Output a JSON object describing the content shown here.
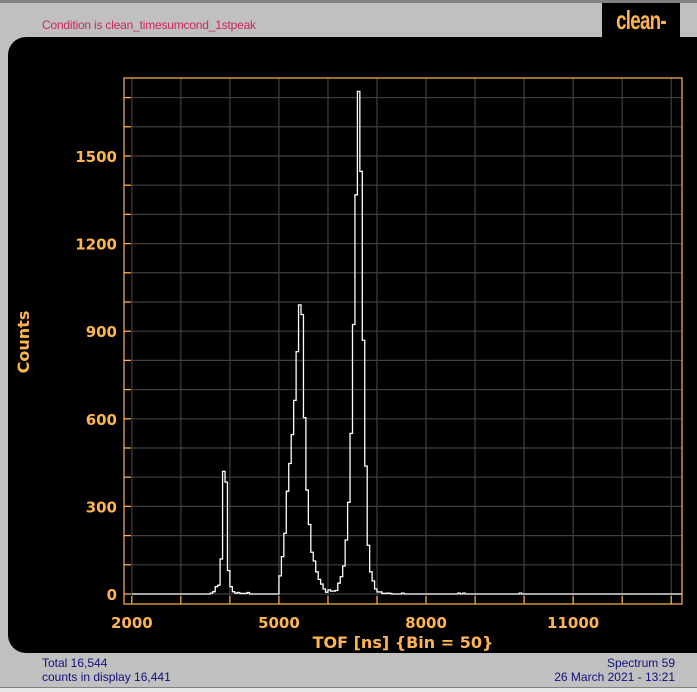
{
  "header": {
    "condition": "Condition is clean_timesumcond_1stpeak",
    "logo": "clean-TOF"
  },
  "footer": {
    "total": "Total 16,544",
    "counts_in_display": "counts in display 16,441",
    "spectrum": "Spectrum 59",
    "date": "26 March 2021 - 13:21"
  },
  "colors": {
    "axis": "#ffb450",
    "grid": "#404040",
    "line": "#ffffff",
    "background": "#000000"
  },
  "chart_data": {
    "type": "line",
    "style": "step histogram",
    "xlabel": "TOF [ns] {Bin = 50}",
    "ylabel": "Counts",
    "bin_width": 50,
    "xlim": [
      1840,
      13220
    ],
    "ylim": [
      0,
      1767
    ],
    "xticks": [
      2000,
      5000,
      8000,
      11000
    ],
    "xtick_labels": [
      "2000",
      "5000",
      "8000",
      "11000"
    ],
    "yticks": [
      0,
      300,
      600,
      900,
      1200,
      1500
    ],
    "ytick_labels": [
      "0",
      "300",
      "600",
      "900",
      "1200",
      "1500"
    ],
    "grid": true,
    "bins_start": [
      2000,
      3600,
      3650,
      3700,
      3750,
      3800,
      3850,
      3900,
      3950,
      4000,
      4050,
      4100,
      4150,
      4200,
      4250,
      4300,
      4350,
      4400,
      5000,
      5050,
      5100,
      5150,
      5200,
      5250,
      5300,
      5350,
      5400,
      5450,
      5500,
      5550,
      5600,
      5650,
      5700,
      5750,
      5800,
      5850,
      5900,
      5950,
      6000,
      6050,
      6100,
      6150,
      6200,
      6250,
      6300,
      6350,
      6400,
      6450,
      6500,
      6550,
      6600,
      6650,
      6700,
      6750,
      6800,
      6850,
      6900,
      6950,
      7000,
      7050,
      7100,
      7150,
      7200,
      7250,
      7300,
      7500,
      7550,
      8650,
      8700,
      8750,
      8800,
      9900,
      9950,
      10000
    ],
    "counts": [
      0,
      3,
      8,
      25,
      30,
      120,
      420,
      383,
      80,
      25,
      8,
      3,
      5,
      2,
      2,
      2,
      5,
      0,
      62,
      128,
      208,
      352,
      447,
      546,
      663,
      830,
      990,
      957,
      604,
      356,
      238,
      143,
      113,
      76,
      50,
      34,
      17,
      6,
      14,
      10,
      10,
      12,
      37,
      59,
      96,
      185,
      314,
      550,
      923,
      1367,
      1721,
      1447,
      869,
      438,
      167,
      76,
      45,
      17,
      7,
      7,
      2,
      2,
      3,
      2,
      0,
      3,
      0,
      3,
      0,
      3,
      0,
      3,
      0,
      0
    ],
    "x_end": 13220
  }
}
